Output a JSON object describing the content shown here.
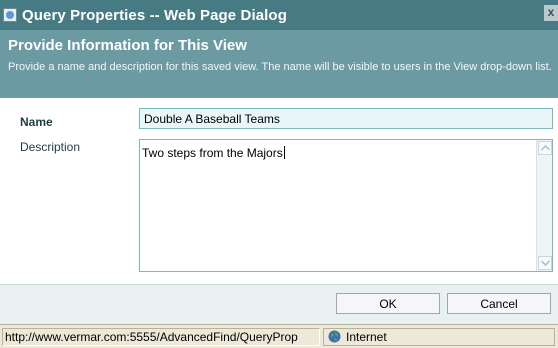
{
  "window": {
    "title": "Query Properties -- Web Page Dialog",
    "close_glyph": "x",
    "icon": "page-icon"
  },
  "header": {
    "heading": "Provide Information for This View",
    "description": "Provide a name and description for this saved view. The name will be visible to users in the View drop-down list."
  },
  "form": {
    "name_label": "Name",
    "name_value": "Double A Baseball Teams",
    "description_label": "Description",
    "description_value": "Two steps from the Majors"
  },
  "buttons": {
    "ok_label": "OK",
    "cancel_label": "Cancel"
  },
  "statusbar": {
    "url": "http://www.vermar.com:5555/AdvancedFind/QueryProp",
    "zone": "Internet",
    "zone_icon": "globe-icon"
  },
  "colors": {
    "titlebar": "#477b84",
    "header_band": "#6b9aa3",
    "input_fill": "#e9f6f8",
    "border_accent": "#7fb6c0"
  }
}
